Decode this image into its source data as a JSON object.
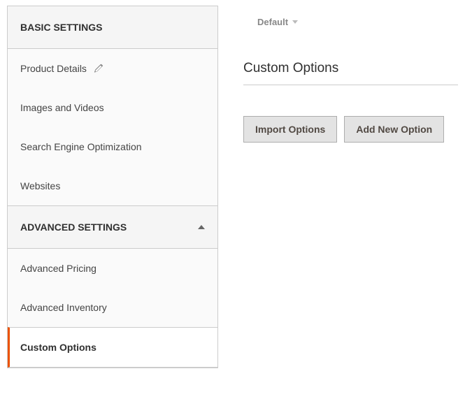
{
  "sidebar": {
    "basic": {
      "header": "BASIC SETTINGS",
      "items": [
        {
          "label": "Product Details"
        },
        {
          "label": "Images and Videos"
        },
        {
          "label": "Search Engine Optimization"
        },
        {
          "label": "Websites"
        }
      ]
    },
    "advanced": {
      "header": "ADVANCED SETTINGS",
      "items": [
        {
          "label": "Advanced Pricing"
        },
        {
          "label": "Advanced Inventory"
        },
        {
          "label": "Custom Options"
        }
      ]
    }
  },
  "main": {
    "scope_label": "Default",
    "page_title": "Custom Options",
    "buttons": {
      "import": "Import Options",
      "add_new": "Add New Option"
    }
  }
}
